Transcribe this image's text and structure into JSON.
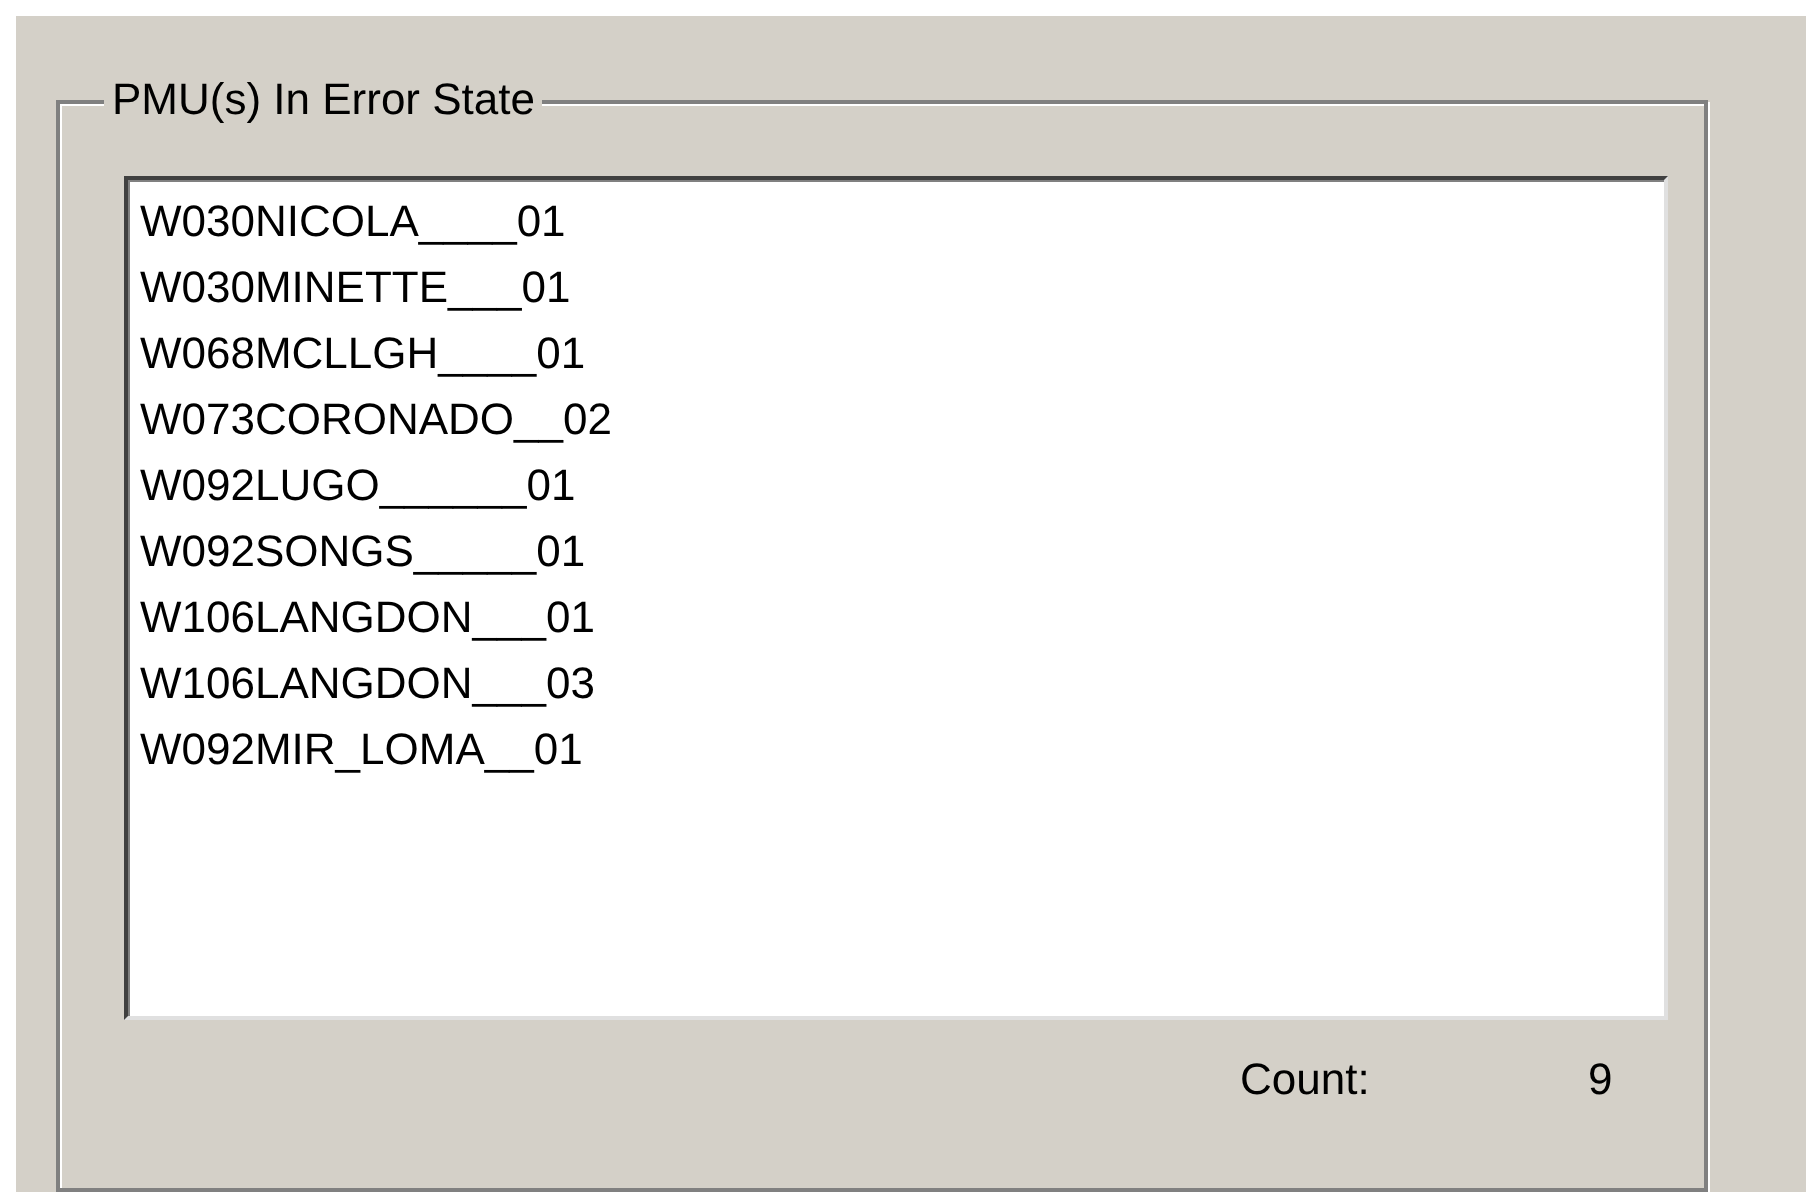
{
  "group_box": {
    "title": "PMU(s) In Error State"
  },
  "list": {
    "items": [
      "W030NICOLA____01",
      "W030MINETTE___01",
      "W068MCLLGH____01",
      "W073CORONADO__02",
      "W092LUGO______01",
      "W092SONGS_____01",
      "W106LANGDON___01",
      "W106LANGDON___03",
      "W092MIR_LOMA__01"
    ]
  },
  "count": {
    "label": "Count:",
    "value": "9"
  }
}
